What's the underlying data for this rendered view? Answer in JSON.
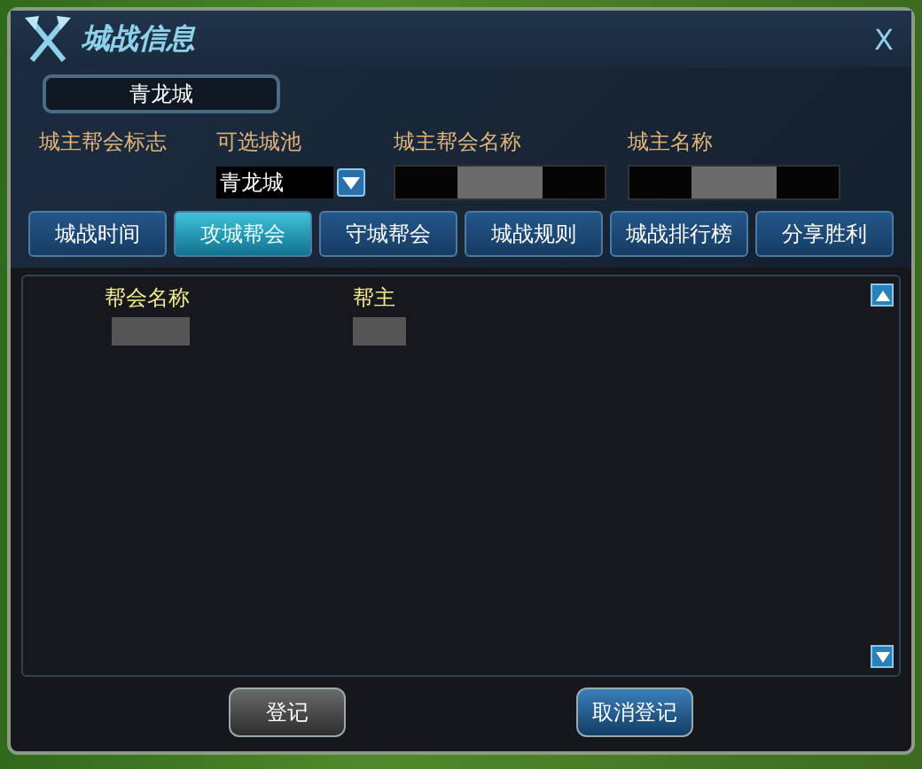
{
  "window": {
    "title": "城战信息",
    "close": "X"
  },
  "city_header": "青龙城",
  "info_labels": [
    "城主帮会标志",
    "可选城池",
    "城主帮会名称",
    "城主名称"
  ],
  "city_select": {
    "value": "青龙城"
  },
  "tabs": [
    {
      "label": "城战时间",
      "selected": false
    },
    {
      "label": "攻城帮会",
      "selected": true
    },
    {
      "label": "守城帮会",
      "selected": false
    },
    {
      "label": "城战规则",
      "selected": false
    },
    {
      "label": "城战排行榜",
      "selected": false
    },
    {
      "label": "分享胜利",
      "selected": false
    }
  ],
  "table": {
    "columns": [
      "帮会名称",
      "帮主"
    ]
  },
  "buttons": [
    {
      "label": "登记",
      "kind": "plain"
    },
    {
      "label": "取消登记",
      "kind": "primary"
    }
  ]
}
